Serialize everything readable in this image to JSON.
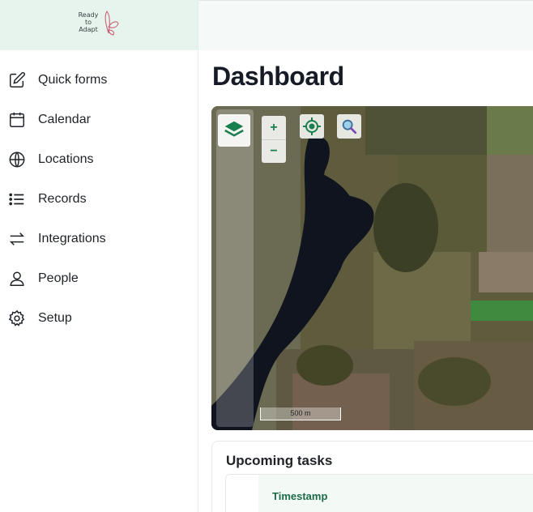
{
  "logo": {
    "line1": "Ready",
    "line2": "to",
    "line3": "Adapt"
  },
  "sidebar": {
    "items": [
      {
        "label": "Quick forms",
        "icon": "edit-icon"
      },
      {
        "label": "Calendar",
        "icon": "calendar-icon"
      },
      {
        "label": "Locations",
        "icon": "globe-icon"
      },
      {
        "label": "Records",
        "icon": "list-icon"
      },
      {
        "label": "Integrations",
        "icon": "arrows-exchange-icon"
      },
      {
        "label": "People",
        "icon": "user-icon"
      },
      {
        "label": "Setup",
        "icon": "gear-icon"
      }
    ]
  },
  "main": {
    "title": "Dashboard",
    "map": {
      "zoom_in": "+",
      "zoom_out": "−",
      "scale_label": "500 m"
    },
    "tasks": {
      "title": "Upcoming tasks",
      "columns": [
        "Timestamp"
      ]
    }
  },
  "colors": {
    "accent": "#1a7f4e",
    "logo_bg": "#e7f4ee",
    "text": "#1f2328"
  }
}
